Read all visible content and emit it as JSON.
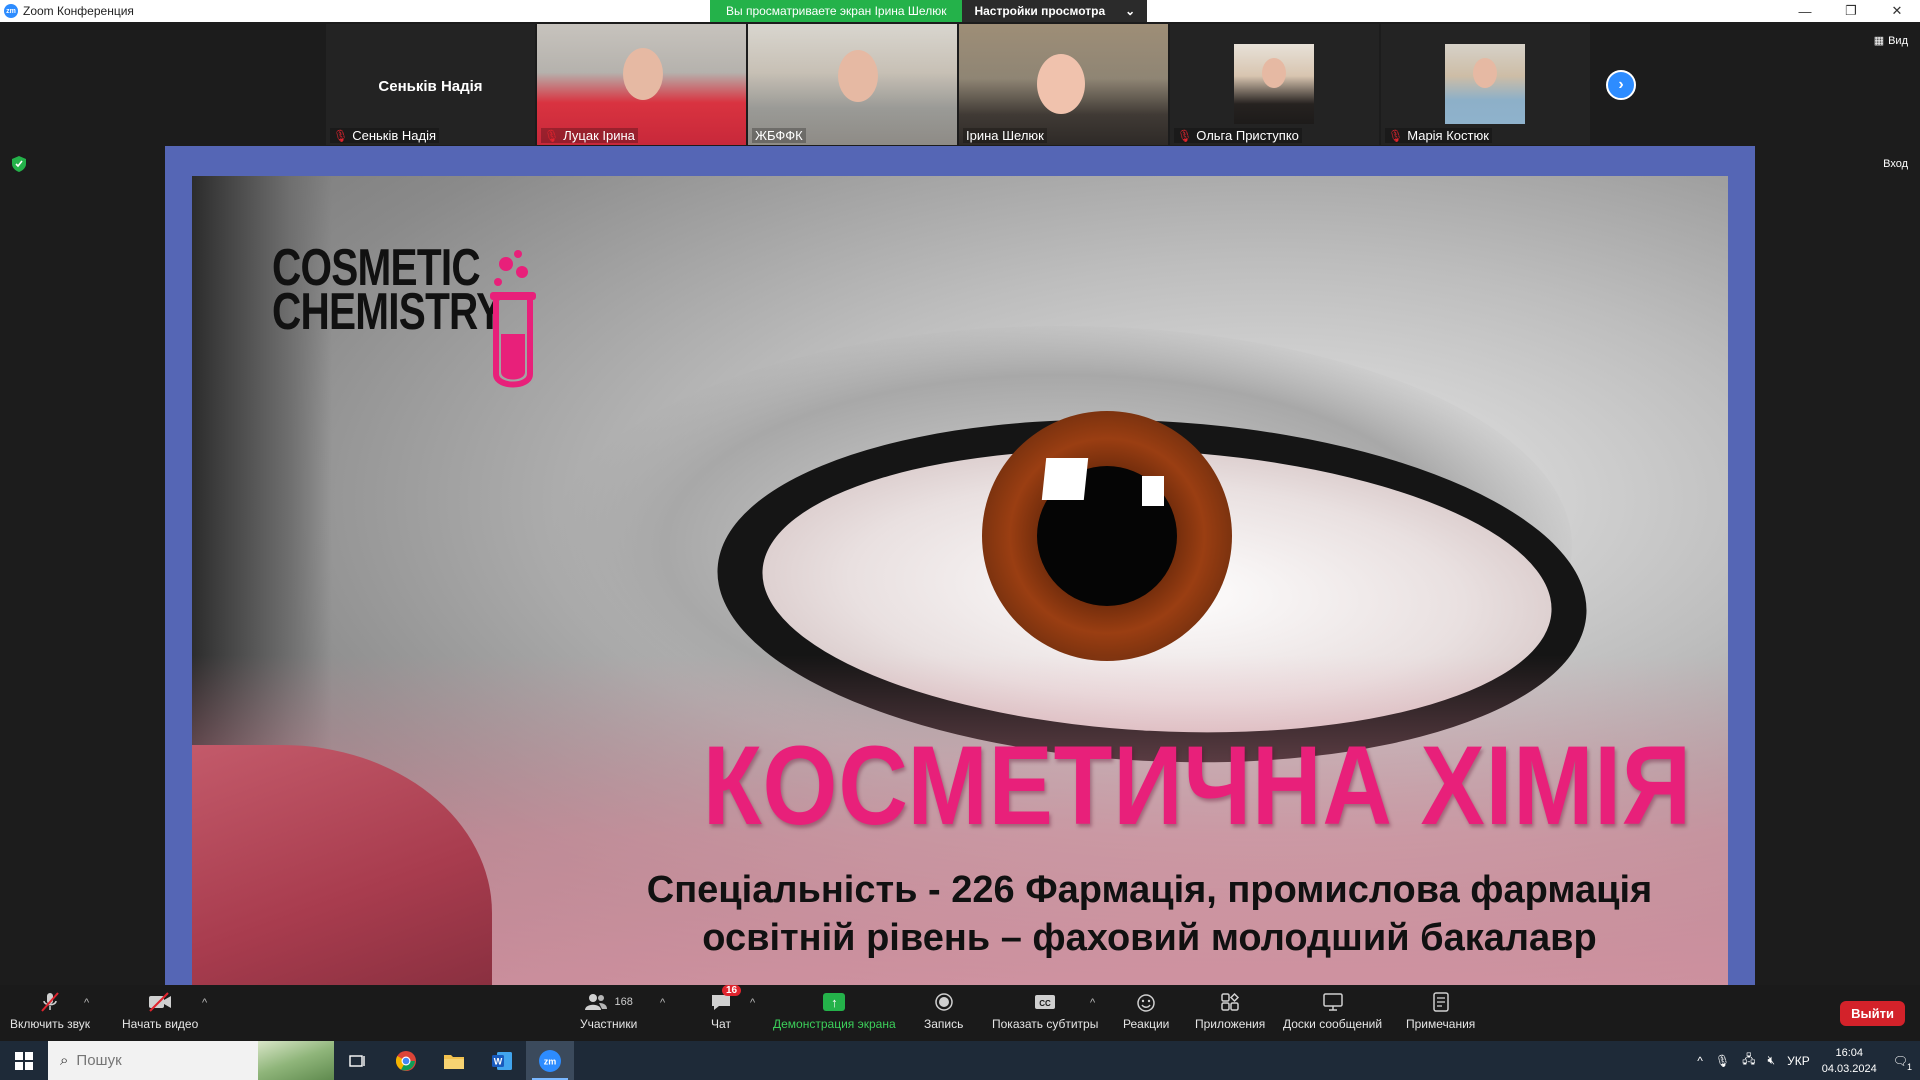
{
  "window": {
    "title": "Zoom Конференция",
    "share_banner": "Вы просматриваете экран Ірина Шелюк",
    "view_settings": "Настройки просмотра"
  },
  "participants": [
    {
      "name": "Сенькiв Надiя",
      "display": "Сенькiв Надiя",
      "muted": true,
      "video": false
    },
    {
      "name": "Луцак Ірина",
      "muted": true,
      "video": true
    },
    {
      "name": "ЖБФФК",
      "muted": false,
      "video": true
    },
    {
      "name": "Ірина Шелюк",
      "muted": false,
      "video": true,
      "active_speaker": true
    },
    {
      "name": "Ольга Приступко",
      "muted": true,
      "video": true
    },
    {
      "name": "Марія Костюк",
      "muted": true,
      "video": true
    }
  ],
  "header_right": {
    "view_label": "Вид",
    "enter_label": "Вход"
  },
  "slide": {
    "logo_line1": "COSMETIC",
    "logo_line2": "CHEMISTRY",
    "title": "КОСМЕТИЧНА ХІМІЯ",
    "subtitle_line1": "Спеціальність - 226 Фармація, промислова фармація",
    "subtitle_line2": "освітній рівень – фаховий молодший бакалавр"
  },
  "toolbar": {
    "unmute": "Включить звук",
    "start_video": "Начать видео",
    "participants": "Участники",
    "participants_count": "168",
    "chat": "Чат",
    "chat_badge": "16",
    "share_screen": "Демонстрация экрана",
    "record": "Запись",
    "captions": "Показать субтитры",
    "reactions": "Реакции",
    "apps": "Приложения",
    "whiteboards": "Доски сообщений",
    "notes": "Примечания",
    "leave": "Выйти"
  },
  "taskbar": {
    "search_placeholder": "Пошук",
    "language": "УКР",
    "time": "16:04",
    "date": "04.03.2024",
    "notifications": "1"
  },
  "colors": {
    "zoom_blue": "#2d8cff",
    "share_green": "#24b24a",
    "slide_pink": "#e8207a",
    "leave_red": "#d3222a",
    "slide_border": "#5566b5"
  }
}
